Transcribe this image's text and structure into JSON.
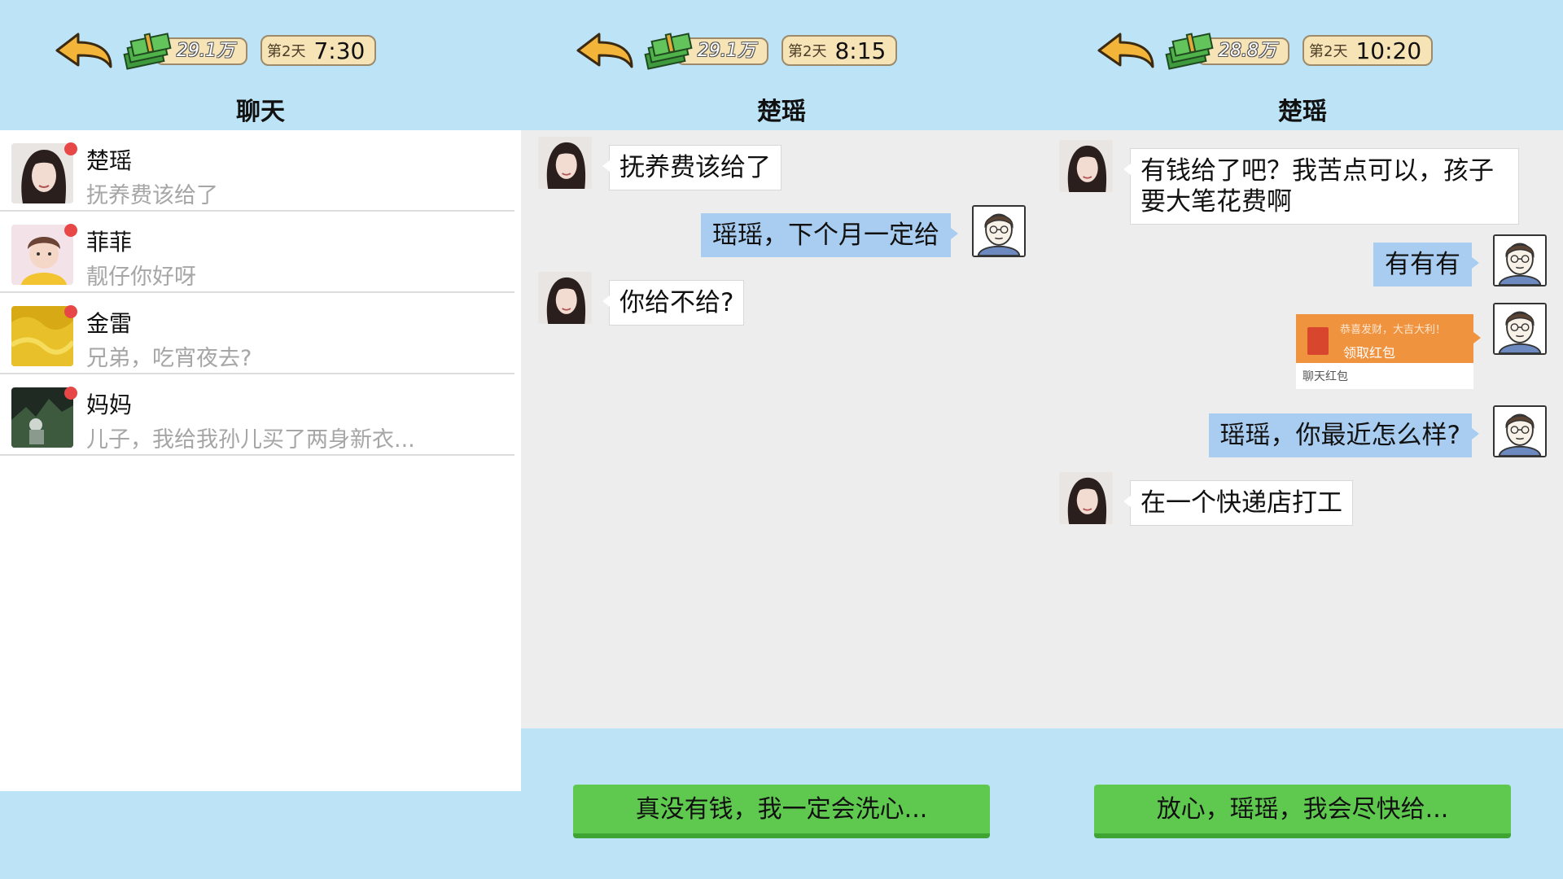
{
  "screens": [
    {
      "header": {
        "money": "29.1万",
        "day": "第2天",
        "time": "7:30"
      },
      "title": "聊天",
      "chats": [
        {
          "name": "楚瑶",
          "preview": "抚养费该给了",
          "unread": true
        },
        {
          "name": "菲菲",
          "preview": "靓仔你好呀",
          "unread": true
        },
        {
          "name": "金雷",
          "preview": "兄弟，吃宵夜去?",
          "unread": true
        },
        {
          "name": "妈妈",
          "preview": "儿子，我给我孙儿买了两身新衣...",
          "unread": true
        }
      ]
    },
    {
      "header": {
        "money": "29.1万",
        "day": "第2天",
        "time": "8:15"
      },
      "title": "楚瑶",
      "messages": [
        {
          "from": "her",
          "text": "抚养费该给了"
        },
        {
          "from": "me",
          "text": "瑶瑶，下个月一定给"
        },
        {
          "from": "her",
          "text": "你给不给?"
        }
      ],
      "reply": "真没有钱，我一定会洗心..."
    },
    {
      "header": {
        "money": "28.8万",
        "day": "第2天",
        "time": "10:20"
      },
      "title": "楚瑶",
      "messages": [
        {
          "from": "her",
          "text": "有钱给了吧？我苦点可以，孩子要大笔花费啊"
        },
        {
          "from": "me",
          "text": "有有有"
        },
        {
          "from": "me",
          "type": "red_packet",
          "wish": "恭喜发财，大吉大利！",
          "action": "领取红包",
          "label": "聊天红包"
        },
        {
          "from": "me",
          "text": "瑶瑶，你最近怎么样?"
        },
        {
          "from": "her",
          "text": "在一个快递店打工"
        }
      ],
      "reply": "放心，瑶瑶，我会尽快给..."
    }
  ],
  "colors": {
    "background": "#bde3f6",
    "chat_bg": "#ededed",
    "my_bubble": "#a9cdf1",
    "reply_button": "#5fc94f",
    "unread_dot": "#e84747",
    "red_packet": "#f0933f"
  }
}
